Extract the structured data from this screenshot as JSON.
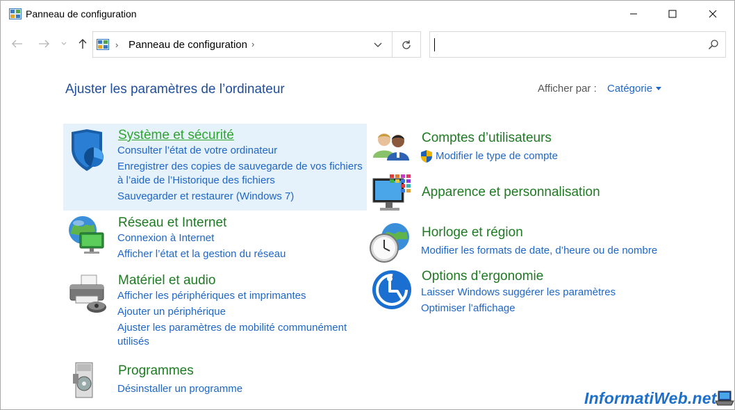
{
  "window": {
    "title": "Panneau de configuration"
  },
  "nav": {
    "breadcrumb": "Panneau de configuration",
    "search_value": ""
  },
  "header": {
    "heading": "Ajuster les paramètres de l’ordinateur",
    "view_by_label": "Afficher par :",
    "view_by_value": "Catégorie"
  },
  "categories": {
    "security": {
      "title": "Système et sécurité",
      "links": [
        "Consulter l’état de votre ordinateur",
        "Enregistrer des copies de sauvegarde de vos fichiers",
        "à l’aide de l’Historique des fichiers",
        "Sauvegarder et restaurer (Windows 7)"
      ]
    },
    "network": {
      "title": "Réseau et Internet",
      "links": [
        "Connexion à Internet",
        "Afficher l’état et la gestion du réseau"
      ]
    },
    "hardware": {
      "title": "Matériel et audio",
      "links": [
        "Afficher les périphériques et imprimantes",
        "Ajouter un périphérique",
        "Ajuster les paramètres de mobilité communément",
        "utilisés"
      ]
    },
    "programs": {
      "title": "Programmes",
      "links": [
        "Désinstaller un programme"
      ]
    },
    "accounts": {
      "title": "Comptes d’utilisateurs",
      "links": [
        "Modifier le type de compte"
      ]
    },
    "appearance": {
      "title": "Apparence et personnalisation",
      "links": []
    },
    "clock": {
      "title": "Horloge et région",
      "links": [
        "Modifier les formats de date, d’heure ou de nombre"
      ]
    },
    "ease": {
      "title": "Options d’ergonomie",
      "links": [
        "Laisser Windows suggérer les paramètres",
        "Optimiser l’affichage"
      ]
    }
  },
  "watermark": {
    "text": "InformatiWeb.net"
  },
  "colors": {
    "category_title": "#1e7b22",
    "link": "#1e66c9",
    "highlight": "#e5f1fb"
  }
}
